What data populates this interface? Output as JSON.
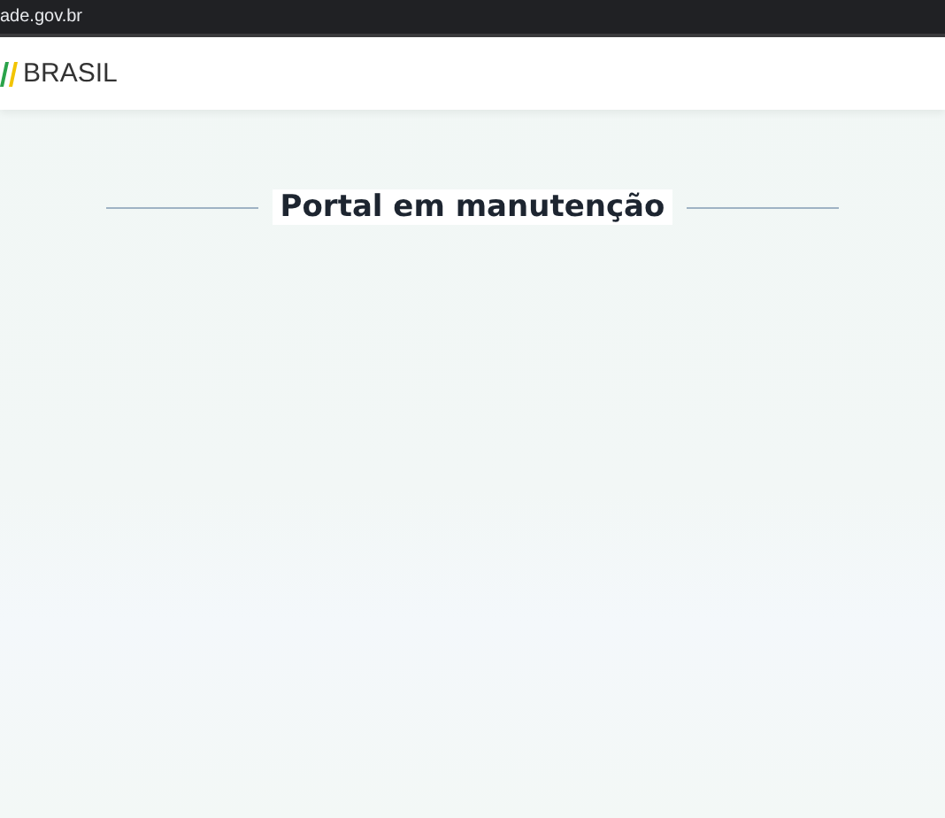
{
  "address_bar": {
    "url": "ade.gov.br"
  },
  "header": {
    "brand": "BRASIL"
  },
  "main": {
    "title": "Portal em manutenção"
  }
}
